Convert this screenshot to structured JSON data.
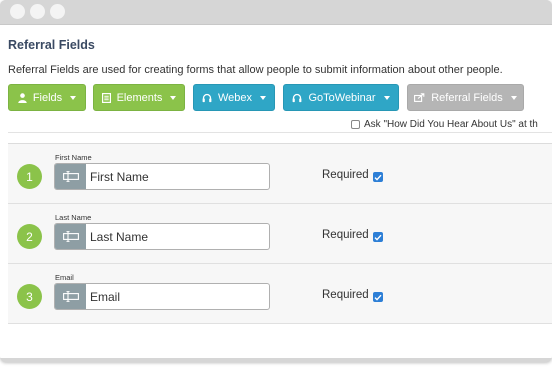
{
  "page": {
    "title": "Referral Fields",
    "description": "Referral Fields are used for creating forms that allow people to submit information about other people."
  },
  "toolbar": {
    "buttons": [
      {
        "label": "Fields",
        "icon": "person-icon",
        "color": "#8bc34a"
      },
      {
        "label": "Elements",
        "icon": "elements-icon",
        "color": "#8bc34a"
      },
      {
        "label": "Webex",
        "icon": "headset-icon",
        "color": "#2fa6c6"
      },
      {
        "label": "GoToWebinar",
        "icon": "headset-icon",
        "color": "#2fa6c6"
      },
      {
        "label": "Referral Fields",
        "icon": "share-icon",
        "color": "#b5b5b5"
      }
    ]
  },
  "ask_option": {
    "label": "Ask \"How Did You Hear About Us\" at th",
    "checked": false
  },
  "fields": [
    {
      "number": "1",
      "label": "First Name",
      "value": "First Name",
      "required_label": "Required",
      "required": true
    },
    {
      "number": "2",
      "label": "Last Name",
      "value": "Last Name",
      "required_label": "Required",
      "required": true
    },
    {
      "number": "3",
      "label": "Email",
      "value": "Email",
      "required_label": "Required",
      "required": true
    }
  ],
  "colors": {
    "accent_green": "#8bc34a",
    "accent_blue": "#2fa6c6",
    "disabled_gray": "#b5b5b5",
    "checkbox_blue": "#2d7fd6",
    "title_color": "#3a4a63"
  }
}
